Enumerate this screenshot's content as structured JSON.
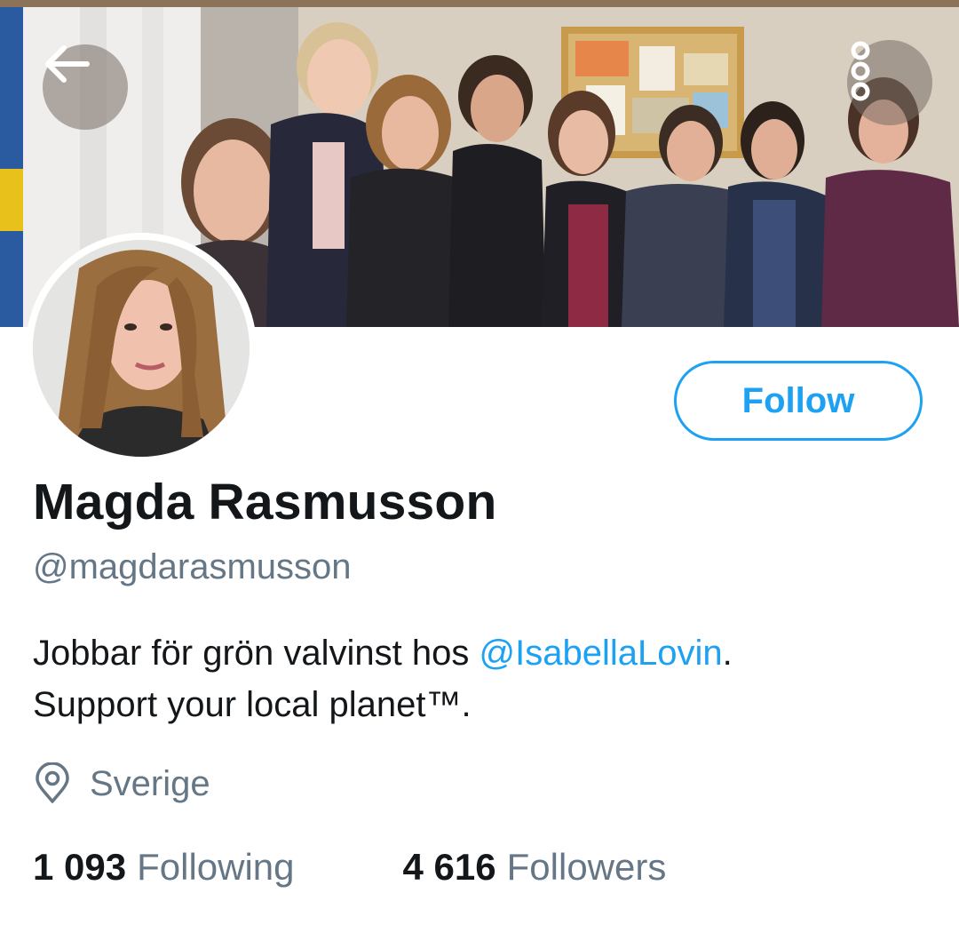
{
  "header": {
    "back_icon": "arrow-left-icon",
    "more_icon": "more-vertical-icon"
  },
  "profile": {
    "display_name": "Magda Rasmusson",
    "handle": "@magdarasmusson",
    "follow_label": "Follow",
    "bio": {
      "line1_prefix": "Jobbar för grön valvinst hos ",
      "line1_mention": "@IsabellaLovin",
      "line1_suffix": ".",
      "line2": "Support your local planet™."
    },
    "location": {
      "icon": "location-pin-icon",
      "text": "Sverige"
    },
    "stats": {
      "following_count": "1 093",
      "following_label": "Following",
      "followers_count": "4 616",
      "followers_label": "Followers"
    }
  },
  "colors": {
    "accent": "#1da1f2",
    "text_primary": "#14171a",
    "text_secondary": "#657786"
  }
}
